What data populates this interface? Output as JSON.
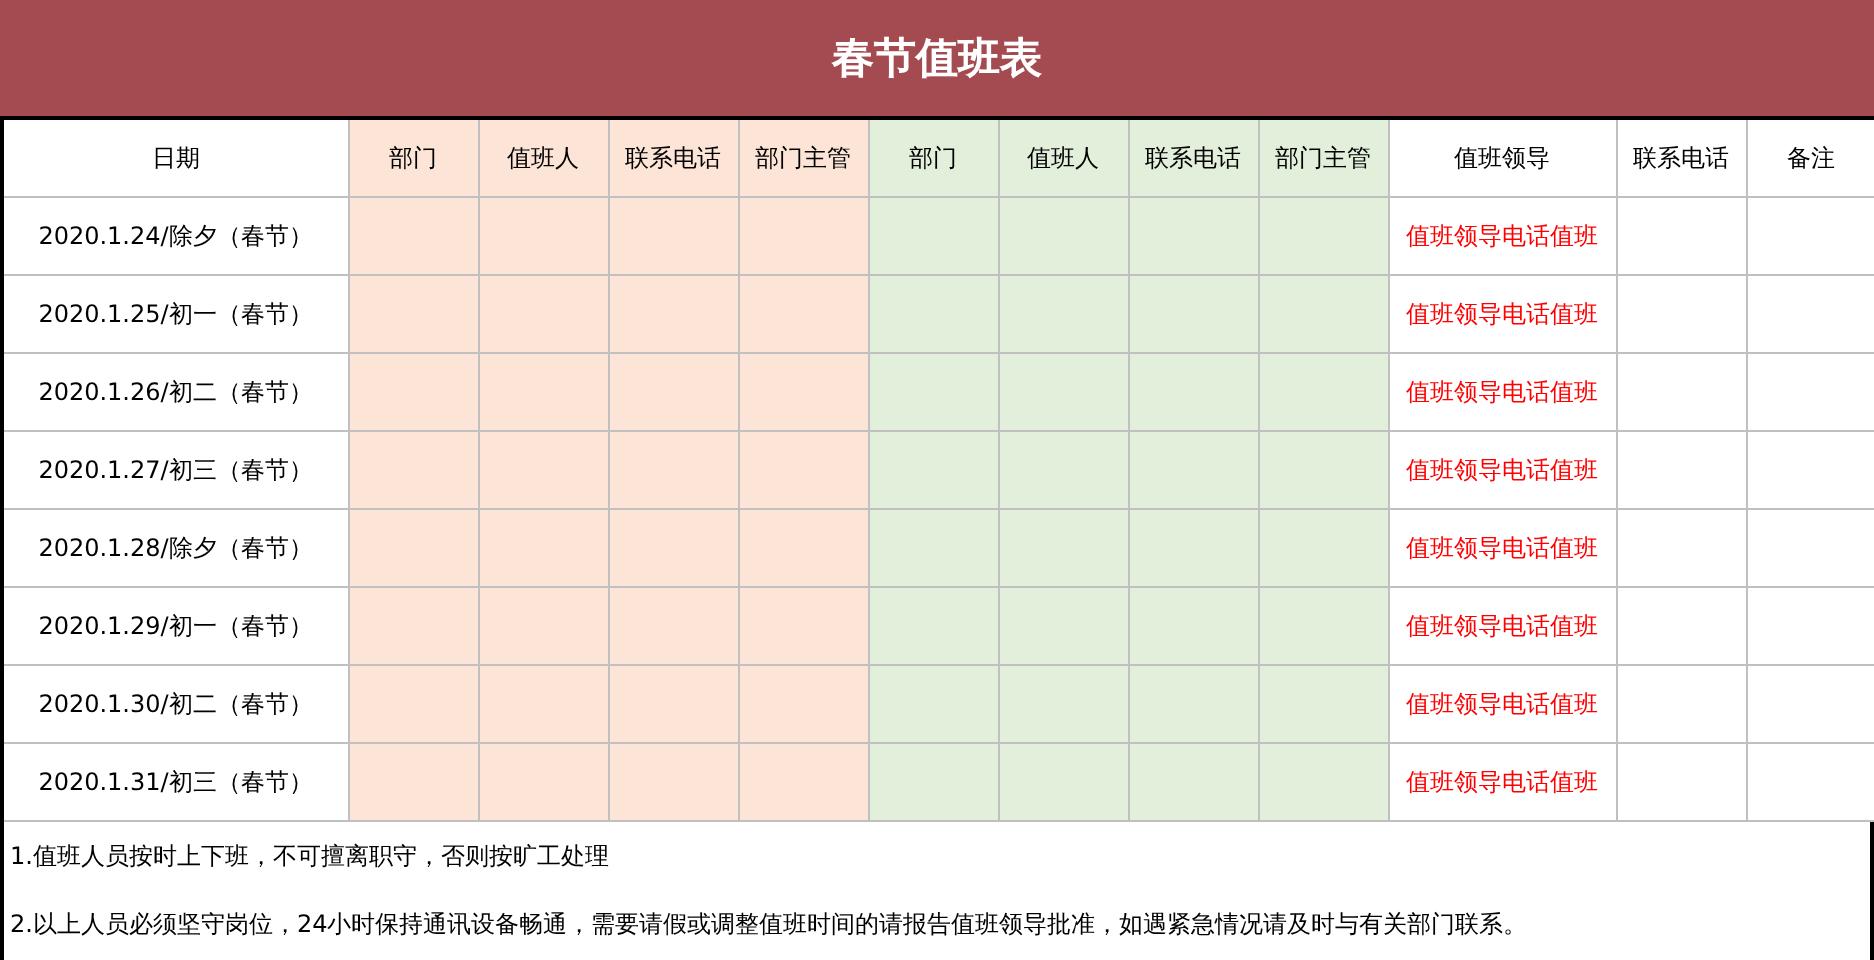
{
  "title": "春节值班表",
  "columns": [
    {
      "label": "日期",
      "color": "#ffffff"
    },
    {
      "label": "部门",
      "color": "#fce4d6"
    },
    {
      "label": "值班人",
      "color": "#fce4d6"
    },
    {
      "label": "联系电话",
      "color": "#fce4d6"
    },
    {
      "label": "部门主管",
      "color": "#fce4d6"
    },
    {
      "label": "部门",
      "color": "#e2efda"
    },
    {
      "label": "值班人",
      "color": "#e2efda"
    },
    {
      "label": "联系电话",
      "color": "#e2efda"
    },
    {
      "label": "部门主管",
      "color": "#e2efda"
    },
    {
      "label": "值班领导",
      "color": "#ffffff"
    },
    {
      "label": "联系电话",
      "color": "#ffffff"
    },
    {
      "label": "备注",
      "color": "#ffffff"
    }
  ],
  "rows": [
    {
      "date": "2020.1.24/除夕（春节）",
      "leader": "值班领导电话值班"
    },
    {
      "date": "2020.1.25/初一（春节）",
      "leader": "值班领导电话值班"
    },
    {
      "date": "2020.1.26/初二（春节）",
      "leader": "值班领导电话值班"
    },
    {
      "date": "2020.1.27/初三（春节）",
      "leader": "值班领导电话值班"
    },
    {
      "date": "2020.1.28/除夕（春节）",
      "leader": "值班领导电话值班"
    },
    {
      "date": "2020.1.29/初一（春节）",
      "leader": "值班领导电话值班"
    },
    {
      "date": "2020.1.30/初二（春节）",
      "leader": "值班领导电话值班"
    },
    {
      "date": "2020.1.31/初三（春节）",
      "leader": "值班领导电话值班"
    }
  ],
  "notes": [
    "1.值班人员按时上下班，不可擅离职守，否则按旷工处理",
    "2.以上人员必须坚守岗位，24小时保持通讯设备畅通，需要请假或调整值班时间的请报告值班领导批准，如遇紧急情况请及时与有关部门联系。"
  ]
}
